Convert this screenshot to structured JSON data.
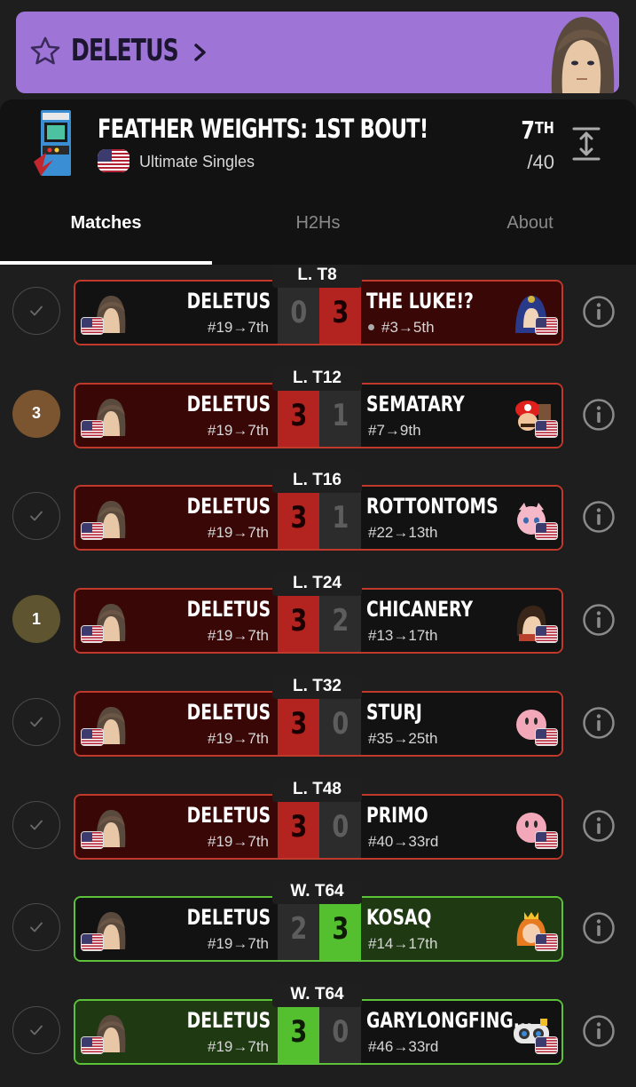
{
  "player": {
    "name": "DELETUS"
  },
  "tournament": {
    "name": "FEATHER WEIGHTS: 1ST BOUT!",
    "event": "Ultimate Singles",
    "placement_num": "7",
    "placement_suffix": "TH",
    "entrants": "/40"
  },
  "tabs": [
    {
      "label": "Matches",
      "active": true
    },
    {
      "label": "H2Hs",
      "active": false
    },
    {
      "label": "About",
      "active": false
    }
  ],
  "matches": [
    {
      "round": "L. T8",
      "status": "check",
      "result": "loss",
      "left": {
        "name": "DELETUS",
        "seed": "#19→7th",
        "score": "0"
      },
      "right": {
        "name": "THE LUKE!?",
        "seed": "#3→5th",
        "score": "3",
        "dot": true
      }
    },
    {
      "round": "L. T12",
      "status": "3",
      "status_color": "#7a5530",
      "result": "win",
      "left": {
        "name": "DELETUS",
        "seed": "#19→7th",
        "score": "3"
      },
      "right": {
        "name": "SEMATARY",
        "seed": "#7→9th",
        "score": "1"
      }
    },
    {
      "round": "L. T16",
      "status": "check",
      "result": "win",
      "left": {
        "name": "DELETUS",
        "seed": "#19→7th",
        "score": "3"
      },
      "right": {
        "name": "ROTTONTOMS",
        "seed": "#22→13th",
        "score": "1"
      }
    },
    {
      "round": "L. T24",
      "status": "1",
      "status_color": "#5e5530",
      "result": "win",
      "left": {
        "name": "DELETUS",
        "seed": "#19→7th",
        "score": "3"
      },
      "right": {
        "name": "CHICANERY",
        "seed": "#13→17th",
        "score": "2"
      }
    },
    {
      "round": "L. T32",
      "status": "check",
      "result": "win",
      "left": {
        "name": "DELETUS",
        "seed": "#19→7th",
        "score": "3"
      },
      "right": {
        "name": "STURJ",
        "seed": "#35→25th",
        "score": "0"
      }
    },
    {
      "round": "L. T48",
      "status": "check",
      "result": "win",
      "left": {
        "name": "DELETUS",
        "seed": "#19→7th",
        "score": "3"
      },
      "right": {
        "name": "PRIMO",
        "seed": "#40→33rd",
        "score": "0"
      }
    },
    {
      "round": "W. T64",
      "status": "check",
      "result": "loss-green",
      "left": {
        "name": "DELETUS",
        "seed": "#19→7th",
        "score": "2"
      },
      "right": {
        "name": "KOSAQ",
        "seed": "#14→17th",
        "score": "3"
      }
    },
    {
      "round": "W. T64",
      "status": "check",
      "result": "win-green",
      "left": {
        "name": "DELETUS",
        "seed": "#19→7th",
        "score": "3"
      },
      "right": {
        "name": "GARYLONGFING...",
        "seed": "#46→33rd",
        "score": "0"
      }
    }
  ]
}
